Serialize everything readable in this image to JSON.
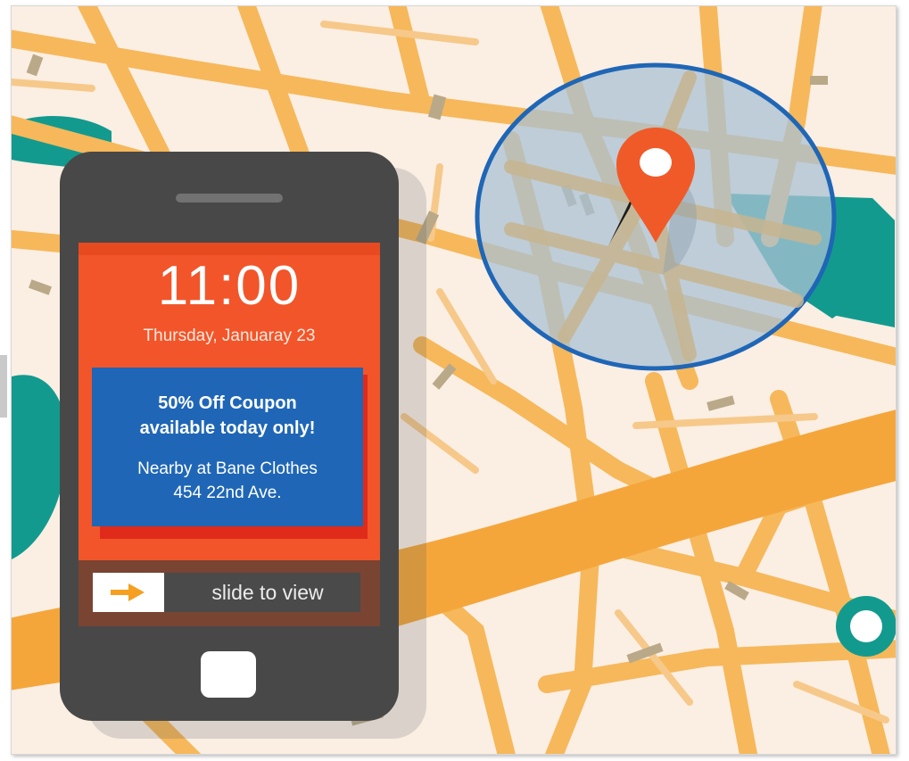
{
  "colors": {
    "map_background": "#fbeee3",
    "road": "#f6b85a",
    "major_road": "#f5a63b",
    "park": "#139a8f",
    "pin": "#f05a28",
    "circle_outline": "#1f66b6",
    "screen": "#f2552a",
    "coupon": "#1f66b6",
    "phone_body": "#484848"
  },
  "phone": {
    "time": "11:00",
    "date": "Thursday, Januaray 23",
    "coupon_headline_line1": "50% Off Coupon",
    "coupon_headline_line2": "available today only!",
    "coupon_detail_line1": "Nearby at Bane Clothes",
    "coupon_detail_line2": "454 22nd Ave.",
    "slide_label": "slide to view",
    "slide_icon": "arrow-right-icon",
    "home_icon": "home-button-icon"
  },
  "map": {
    "marker_icon": "location-pin-icon",
    "marker_dot_icon": "map-dot-icon"
  }
}
